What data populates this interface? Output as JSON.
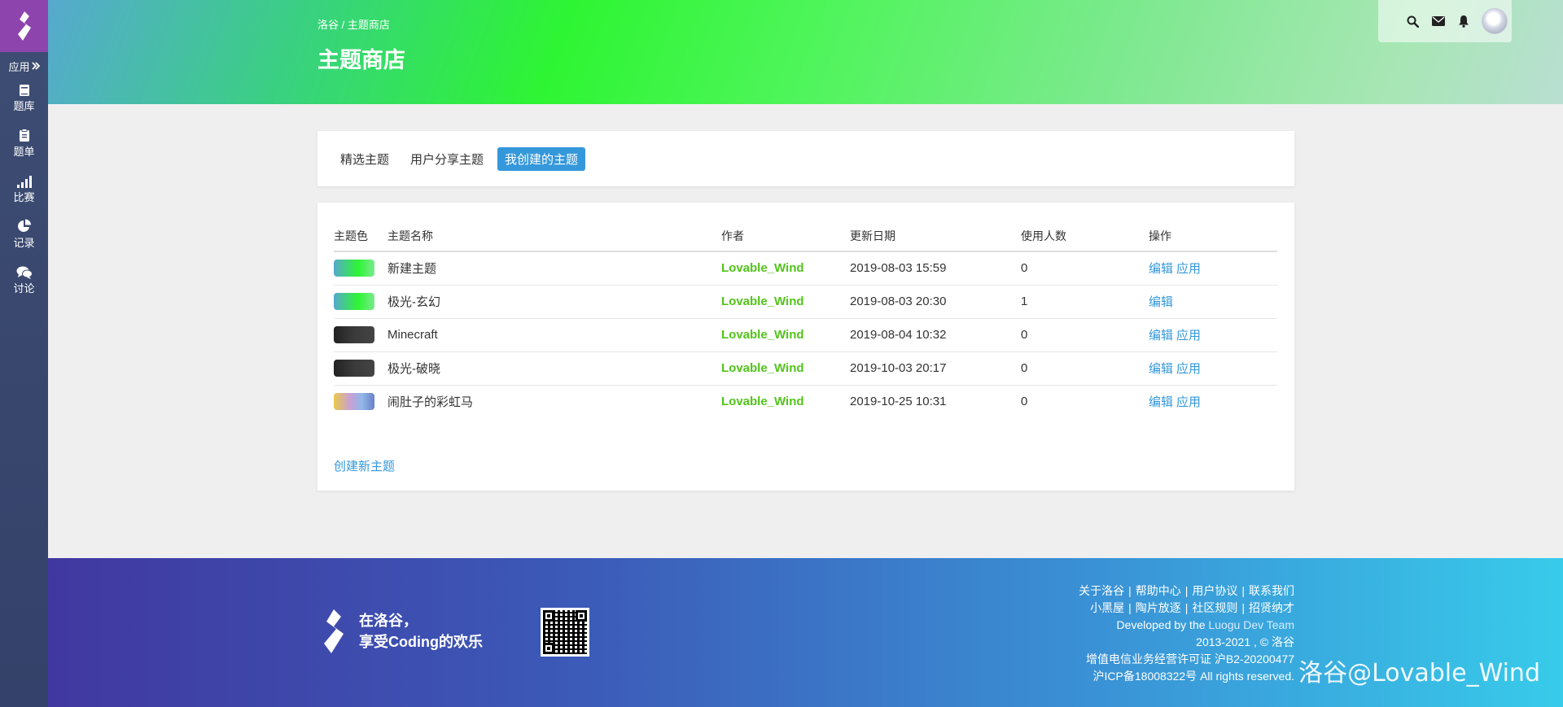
{
  "sidebar": {
    "app_label": "应用",
    "items": [
      {
        "label": "题库",
        "icon": "book-icon"
      },
      {
        "label": "题单",
        "icon": "clipboard-icon"
      },
      {
        "label": "比赛",
        "icon": "signal-bars-icon"
      },
      {
        "label": "记录",
        "icon": "pie-chart-icon"
      },
      {
        "label": "讨论",
        "icon": "comments-icon"
      }
    ]
  },
  "header": {
    "breadcrumb": "洛谷 / 主题商店",
    "title": "主题商店"
  },
  "tabs": [
    {
      "label": "精选主题",
      "active": false
    },
    {
      "label": "用户分享主题",
      "active": false
    },
    {
      "label": "我创建的主题",
      "active": true
    }
  ],
  "table": {
    "columns": [
      "主题色",
      "主题名称",
      "作者",
      "更新日期",
      "使用人数",
      "操作"
    ],
    "rows": [
      {
        "name": "新建主题",
        "author": "Lovable_Wind",
        "date": "2019-08-03 15:59",
        "users": "0",
        "edit": "编辑",
        "apply": "应用"
      },
      {
        "name": "极光-玄幻",
        "author": "Lovable_Wind",
        "date": "2019-08-03 20:30",
        "users": "1",
        "edit": "编辑",
        "apply": ""
      },
      {
        "name": "Minecraft",
        "author": "Lovable_Wind",
        "date": "2019-08-04 10:32",
        "users": "0",
        "edit": "编辑",
        "apply": "应用"
      },
      {
        "name": "极光-破晓",
        "author": "Lovable_Wind",
        "date": "2019-10-03 20:17",
        "users": "0",
        "edit": "编辑",
        "apply": "应用"
      },
      {
        "name": "闹肚子的彩虹马",
        "author": "Lovable_Wind",
        "date": "2019-10-25 10:31",
        "users": "0",
        "edit": "编辑",
        "apply": "应用"
      }
    ],
    "create_label": "创建新主题"
  },
  "footer": {
    "slogan_line1": "在洛谷，",
    "slogan_line2": "享受Coding的欢乐",
    "links_row1": [
      "关于洛谷",
      "帮助中心",
      "用户协议",
      "联系我们"
    ],
    "links_row2": [
      "小黑屋",
      "陶片放逐",
      "社区规则",
      "招贤纳才"
    ],
    "developed_by": "Developed by the ",
    "team": "Luogu Dev Team",
    "copyright": "2013-2021 , © 洛谷",
    "license": "增值电信业务经营许可证 沪B2-20200477",
    "icp": "沪ICP备18008322号 All rights reserved.",
    "watermark": "洛谷@Lovable_Wind"
  },
  "colors": {
    "accent": "#3498db",
    "author_green": "#52c41a",
    "logo_purple": "#8e44ad",
    "sidebar": "#3e4d73"
  }
}
